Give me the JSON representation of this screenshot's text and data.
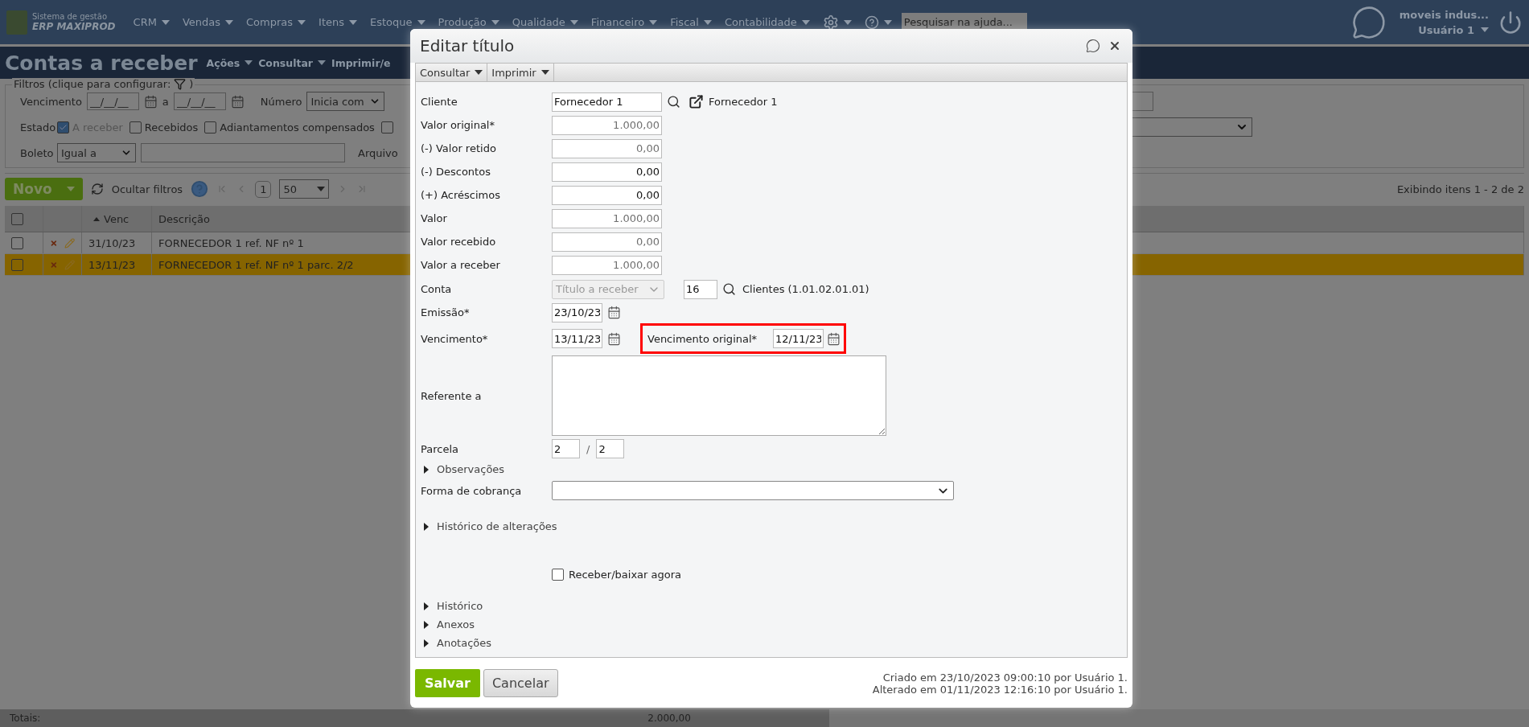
{
  "top_bar": {
    "logo_line_1": "Sistema de gestão",
    "logo_line_2": "ERP MAXIPROD",
    "menus": [
      "CRM",
      "Vendas",
      "Compras",
      "Itens",
      "Estoque",
      "Produção",
      "Qualidade",
      "Financeiro",
      "Fiscal",
      "Contabilidade"
    ],
    "search": {
      "placeholder": "Pesquisar na ajuda..."
    },
    "company": "moveis indus...",
    "user": "Usuário 1"
  },
  "page": {
    "title": "Contas a receber",
    "actions": [
      "Ações",
      "Consultar",
      "Imprimir/e"
    ]
  },
  "filters": {
    "legend_start": "Filtros (clique para configurar:",
    "legend_end": ")",
    "due_label": "Vencimento",
    "date_from": {
      "placeholder": "__/__/__"
    },
    "range_separator": "a",
    "date_to": {
      "placeholder": "__/__/__"
    },
    "number_label": "Número",
    "number_mode": "Inicia com",
    "state_label": "Estado",
    "states": [
      {
        "label": "A receber",
        "checked": true
      },
      {
        "label": "Recebidos",
        "checked": false
      },
      {
        "label": "Adiantamentos compensados",
        "checked": false
      },
      {
        "checked": false
      }
    ],
    "boleto_label": "Boleto",
    "boleto_mode": "Igual a",
    "file_label": "Arquivo"
  },
  "toolbar": {
    "new": "Novo",
    "hide_filters": "Ocultar filtros",
    "page": "1",
    "page_size": "50",
    "summary": "Exibindo itens 1 - 2 de 2"
  },
  "table": {
    "header_checked": false,
    "columns": [
      "Venc",
      "Descrição"
    ],
    "rows": [
      {
        "venc": "31/10/23",
        "description": "FORNECEDOR 1 ref. NF nº 1",
        "checked": false,
        "selected": false
      },
      {
        "venc": "13/11/23",
        "description": "FORNECEDOR 1 ref. NF nº 1 parc. 2/2",
        "checked": false,
        "selected": true
      }
    ],
    "totals_label": "Totais:",
    "total": "2.000,00"
  },
  "dialog": {
    "title": "Editar título",
    "menus": [
      "Consultar",
      "Imprimir"
    ],
    "fields": [
      {
        "kind": "lookup",
        "label": "Cliente",
        "value": "Fornecedor 1",
        "link": "Fornecedor 1"
      },
      {
        "kind": "amount",
        "label": "Valor original*",
        "value": "1.000,00",
        "readonly": true
      },
      {
        "kind": "amount",
        "label": "(-) Valor retido",
        "value": "0,00",
        "readonly": true
      },
      {
        "kind": "amount",
        "label": "(-) Descontos",
        "value": "0,00",
        "readonly": false
      },
      {
        "kind": "amount",
        "label": "(+) Acréscimos",
        "value": "0,00",
        "readonly": false
      },
      {
        "kind": "amount",
        "label": "Valor",
        "value": "1.000,00",
        "readonly": true
      },
      {
        "kind": "amount",
        "label": "Valor recebido",
        "value": "0,00",
        "readonly": true
      },
      {
        "kind": "amount",
        "label": "Valor a receber",
        "value": "1.000,00",
        "readonly": true
      },
      {
        "kind": "account",
        "label": "Conta",
        "value": "Título a receber",
        "disabled": true,
        "code": "16",
        "account": "Clientes (1.01.02.01.01)"
      },
      {
        "kind": "date",
        "label": "Emissão*",
        "value": "23/10/23"
      },
      {
        "kind": "date",
        "label": "Vencimento*",
        "value": "13/11/23",
        "extra": {
          "label": "Vencimento original*",
          "value": "12/11/23",
          "highlighted": true
        }
      },
      {
        "kind": "textarea",
        "label": "Referente a"
      },
      {
        "kind": "installment",
        "label": "Parcela",
        "value": "2",
        "separator": "/",
        "total": "2"
      },
      {
        "kind": "section",
        "label": "Observações",
        "expanded": false
      },
      {
        "kind": "select",
        "label": "Forma de cobrança"
      },
      {
        "kind": "section",
        "label": "Histórico de alterações",
        "expanded": false
      },
      {
        "kind": "checkbox",
        "label": "Receber/baixar agora",
        "checked": false
      },
      {
        "kind": "section",
        "label": "Histórico",
        "expanded": false
      },
      {
        "kind": "section",
        "label": "Anexos",
        "expanded": false
      },
      {
        "kind": "section",
        "label": "Anotações",
        "expanded": false
      }
    ],
    "save": "Salvar",
    "cancel": "Cancelar",
    "created": "Criado em 23/10/2023 09:00:10 por Usuário 1.",
    "altered": "Alterado em 01/11/2023 12:16:10 por Usuário 1."
  }
}
